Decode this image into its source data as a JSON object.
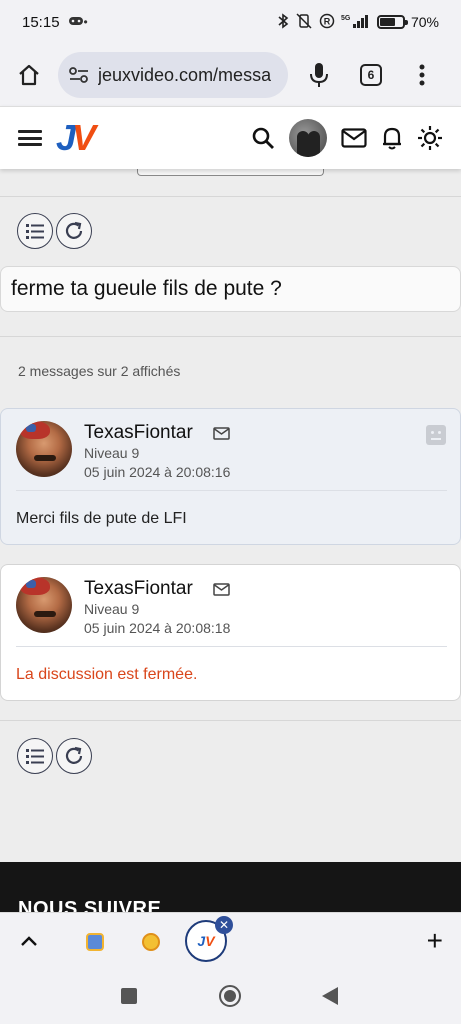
{
  "status_bar": {
    "time": "15:15",
    "battery_text": "70%",
    "battery_level": 0.7,
    "network": "5G"
  },
  "browser": {
    "url": "jeuxvideo.com/messa",
    "tab_count": "6"
  },
  "site": {
    "logo_j": "J",
    "logo_v": "V"
  },
  "topic": {
    "title": "ferme ta gueule fils de pute ?",
    "message_count": "2 messages sur 2 affichés"
  },
  "messages": [
    {
      "author": "TexasFiontar",
      "level": "Niveau 9",
      "date": "05 juin 2024 à 20:08:16",
      "body": "Merci fils de pute de LFI"
    },
    {
      "author": "TexasFiontar",
      "level": "Niveau 9",
      "date": "05 juin 2024 à 20:08:18",
      "body": "La discussion est fermée."
    }
  ],
  "footer": {
    "follow_title": "NOUS SUIVRE"
  },
  "colors": {
    "accent_orange": "#f04e12",
    "accent_blue": "#1e5fbf",
    "closed_text": "#d9461b"
  }
}
